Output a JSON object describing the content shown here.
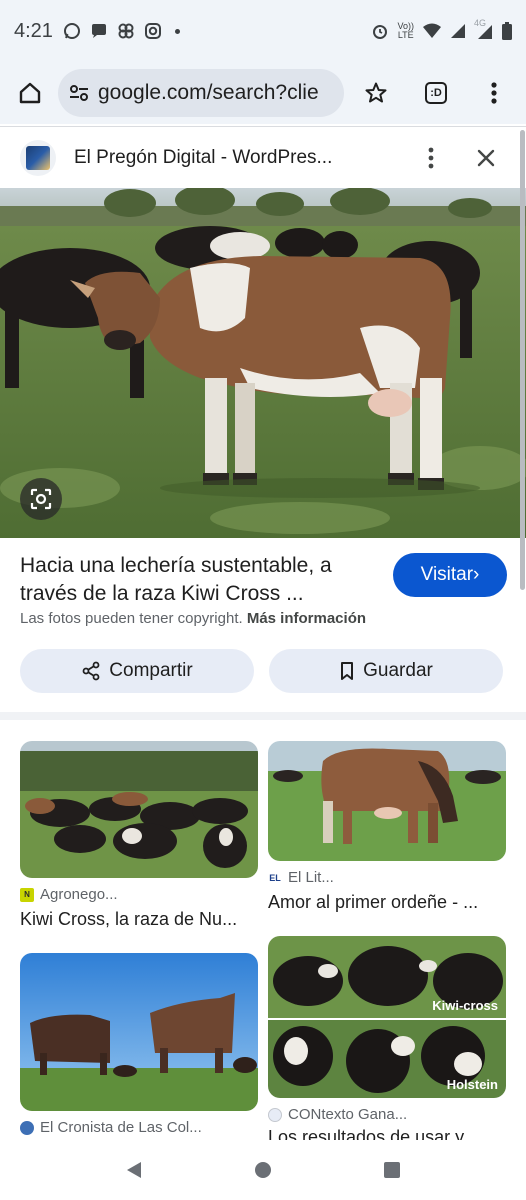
{
  "status_bar": {
    "time": "4:21",
    "left_icons": [
      "whatsapp-icon",
      "chat-icon",
      "pinwheel-icon",
      "instagram-icon",
      "dot-icon"
    ],
    "right_icons": [
      "alarm-icon",
      "volte-icon",
      "wifi-icon",
      "signal-icon",
      "4g-signal-icon",
      "battery-icon"
    ],
    "volte_label_top": "Vo))",
    "volte_label_bottom": "LTE",
    "network_label": "4G"
  },
  "browser": {
    "url": "google.com/search?clie",
    "tab_label": ":D"
  },
  "panel": {
    "site_title": "El Pregón Digital - WordPres..."
  },
  "detail": {
    "title": "Hacia una lechería sustentable, a través de la raza Kiwi Cross ...",
    "visit_label": "Visitar›",
    "copyright_text": "Las fotos pueden tener copyright.",
    "more_info_label": "Más información",
    "share_label": "Compartir",
    "save_label": "Guardar"
  },
  "results": [
    {
      "source": "Agronego...",
      "caption": "Kiwi Cross, la raza de Nu...",
      "icon_color": "#c8d400",
      "icon_text": "N"
    },
    {
      "source": "El Lit...",
      "caption": "Amor al primer ordeñe - ...",
      "icon_color": "#ffffff",
      "icon_text": "EL"
    },
    {
      "source": "El Cronista de Las Col...",
      "caption": "",
      "icon_color": "#3d6fb5",
      "icon_text": ""
    },
    {
      "source": "CONtexto Gana...",
      "caption": "Los resultados de usar y...",
      "icon_color": "#e7ecf6",
      "icon_text": ""
    }
  ],
  "overlays": {
    "kiwi_cross": "Kiwi-cross",
    "holstein": "Holstein"
  },
  "colors": {
    "accent": "#0b57d0",
    "chrome_bg": "#f0f4f9",
    "button_bg": "#e7ecf6"
  }
}
